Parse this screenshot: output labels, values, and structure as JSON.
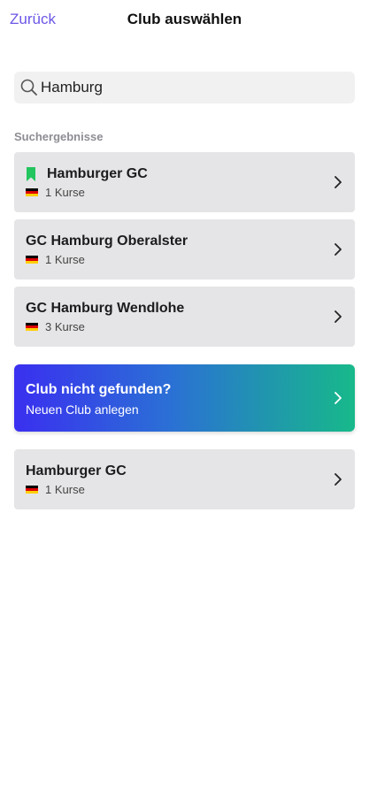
{
  "header": {
    "back_label": "Zurück",
    "title": "Club auswählen"
  },
  "search": {
    "value": "Hamburg",
    "icon": "search-icon"
  },
  "results": {
    "section_label": "Suchergebnisse",
    "items": [
      {
        "name": "Hamburger GC",
        "courses": "1 Kurse",
        "bookmarked": true
      },
      {
        "name": "GC Hamburg Oberalster",
        "courses": "1 Kurse",
        "bookmarked": false
      },
      {
        "name": "GC Hamburg Wendlohe",
        "courses": "3 Kurse",
        "bookmarked": false
      }
    ]
  },
  "cta": {
    "title": "Club nicht gefunden?",
    "subtitle": "Neuen Club anlegen"
  },
  "extra_item": {
    "name": "Hamburger GC",
    "courses": "1 Kurse"
  },
  "colors": {
    "accent": "#6b57e6",
    "bookmark": "#22c55e",
    "card_bg": "#e5e5e7",
    "gradient_start": "#3a2ff0",
    "gradient_end": "#17b98a"
  }
}
